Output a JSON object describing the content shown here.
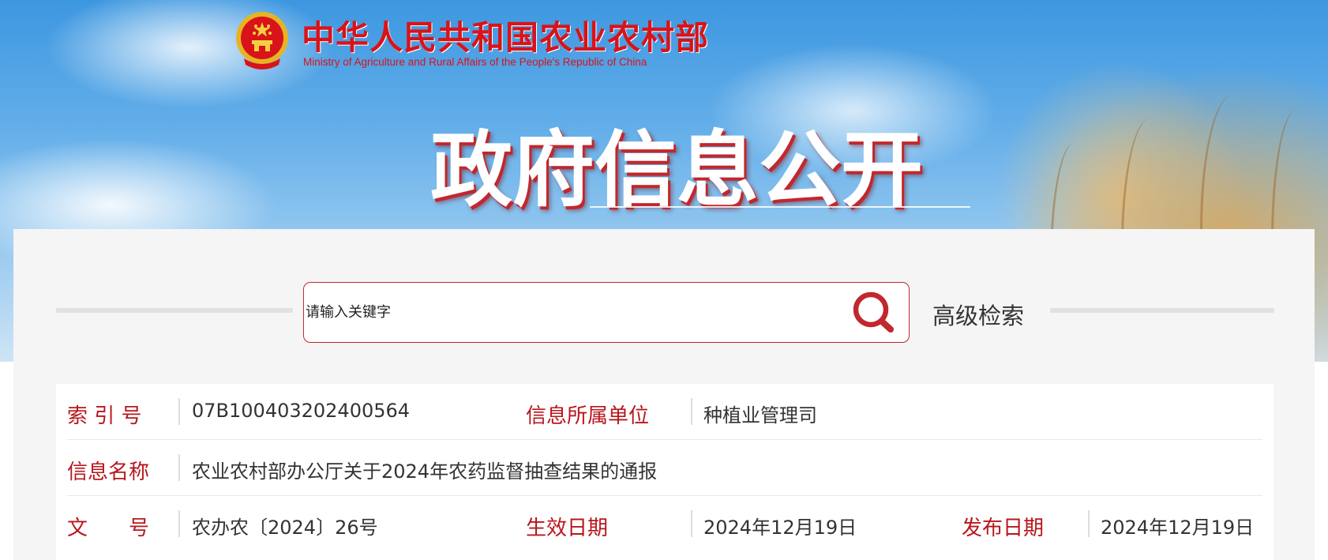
{
  "header": {
    "ministry_name_cn": "中华人民共和国农业农村部",
    "ministry_name_en": "Ministry of Agriculture and Rural Affairs of the People's Republic of China",
    "section_title": "政府信息公开"
  },
  "search": {
    "placeholder": "请输入关键字",
    "advanced_label": "高级检索"
  },
  "document_meta": {
    "index_label": "索 引 号",
    "index_value": "07B100403202400564",
    "unit_label": "信息所属单位",
    "unit_value": "种植业管理司",
    "name_label": "信息名称",
    "name_value": "农业农村部办公厅关于2024年农药监督抽查结果的通报",
    "doc_no_label": "文　　号",
    "doc_no_value": "农办农〔2024〕26号",
    "effective_label": "生效日期",
    "effective_value": "2024年12月19日",
    "publish_label": "发布日期",
    "publish_value": "2024年12月19日"
  },
  "colors": {
    "brand_red": "#d8131a",
    "label_red": "#b8161d",
    "sky_blue": "#4a9fe3",
    "panel_bg": "#f5f5f5"
  },
  "icons": {
    "emblem": "national-emblem-icon",
    "search": "search-icon"
  }
}
